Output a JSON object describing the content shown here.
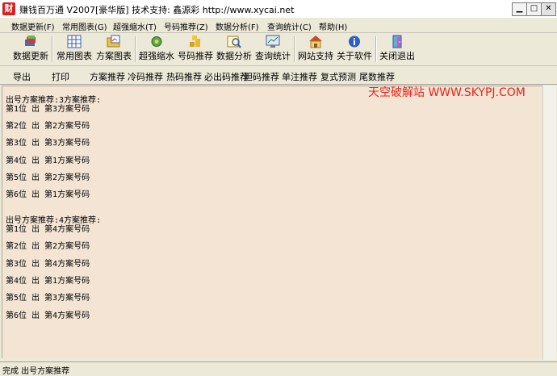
{
  "window": {
    "title": "赚钱百万通  V2007[豪华版]  技术支持: 鑫源彩 http://www.xycai.net"
  },
  "menu": [
    "数据更新(F)",
    "常用图表(G)",
    "超强缩水(T)",
    "号码推荐(Z)",
    "数据分析(F)",
    "查询统计(C)",
    "帮助(H)"
  ],
  "toolbar": [
    "数据更新",
    "常用图表",
    "方案图表",
    "超强缩水",
    "号码推荐",
    "数据分析",
    "查询统计",
    "网站支持",
    "关于软件",
    "关闭退出"
  ],
  "subtoolbar": [
    "导出",
    "打印",
    "方案推荐",
    "冷码推荐",
    "热码推荐",
    "必出码推荐",
    "胆码推荐",
    "单注推荐",
    "复式预测",
    "尾数推荐"
  ],
  "watermark": "天空破解站 WWW.SKYPJ.COM",
  "content_lines": [
    "出号方案推荐:3方案推荐:",
    "第1位 出 第3方案号码",
    "第2位 出 第2方案号码",
    "第3位 出 第3方案号码",
    "第4位 出 第1方案号码",
    "第5位 出 第2方案号码",
    "第6位 出 第1方案号码",
    "出号方案推荐:4方案推荐:",
    "第1位 出 第4方案号码",
    "第2位 出 第2方案号码",
    "第3位 出 第4方案号码",
    "第4位 出 第1方案号码",
    "第5位 出 第3方案号码",
    "第6位 出 第4方案号码"
  ],
  "status": "完成 出号方案推荐",
  "icons": {
    "app": "app-logo-icon",
    "minimize": "minimize-icon",
    "maximize": "maximize-icon",
    "close": "close-icon"
  }
}
